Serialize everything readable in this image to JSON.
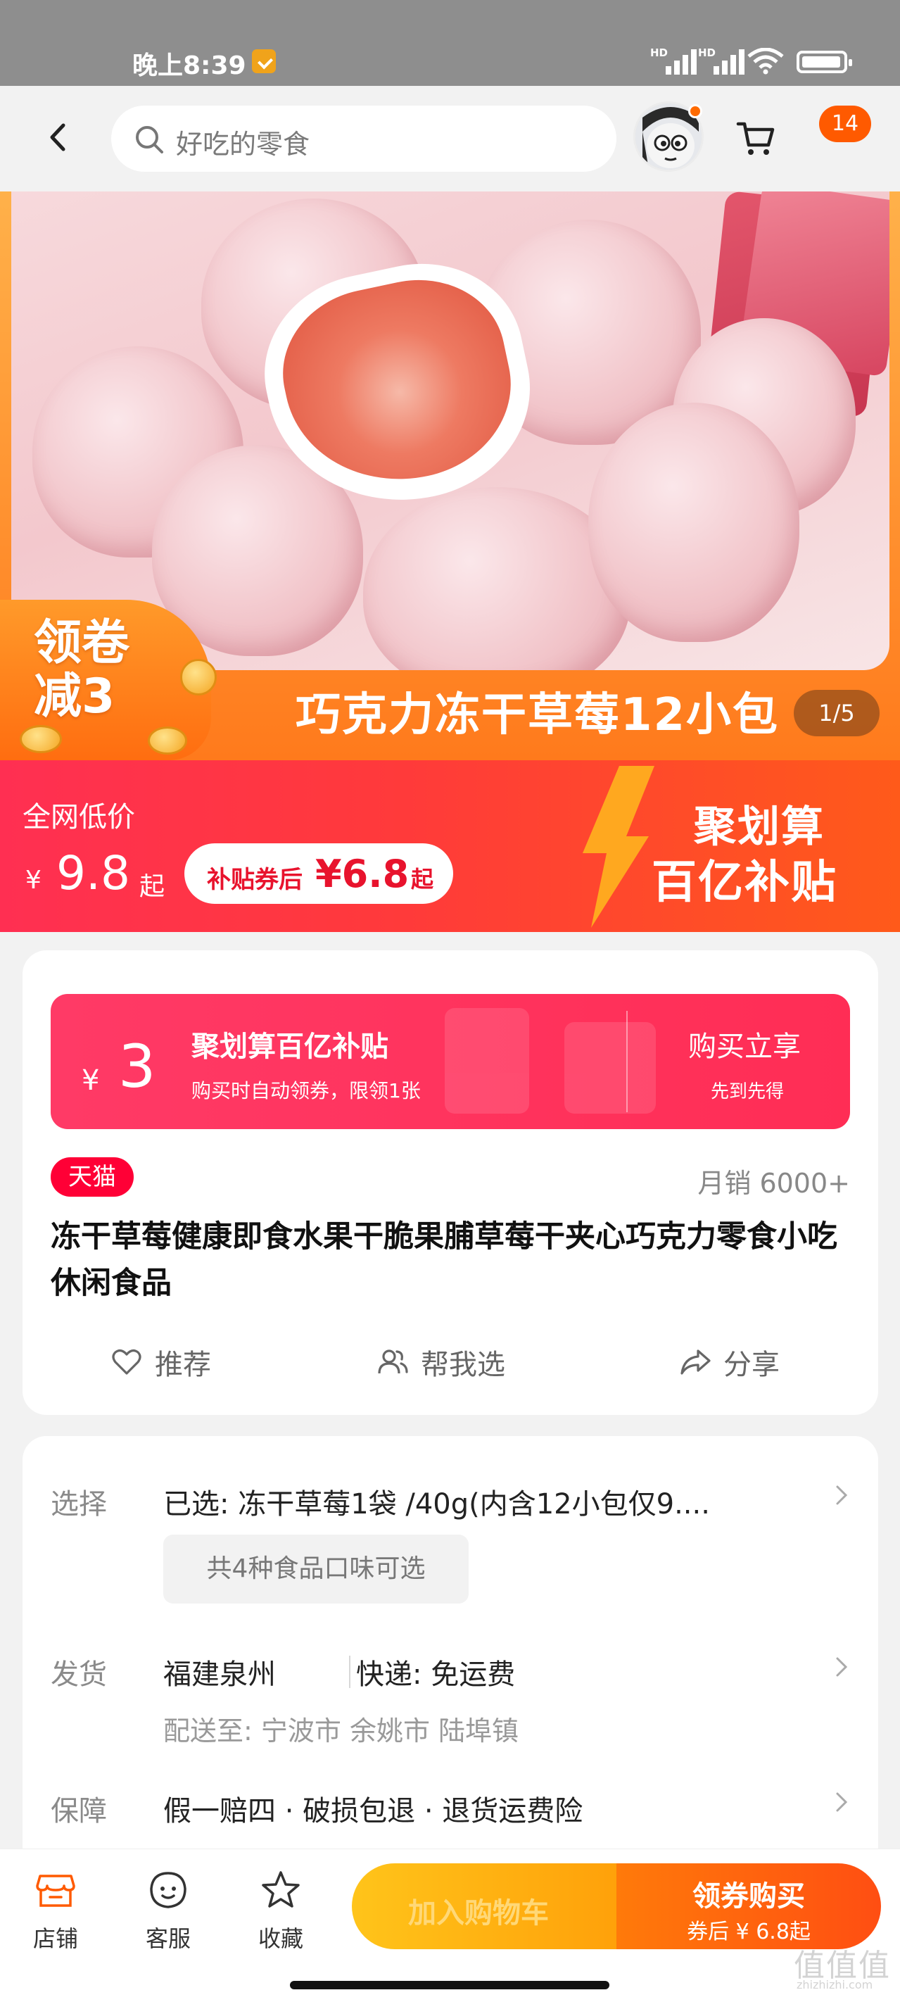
{
  "status_bar": {
    "time": "晚上8:39",
    "hd1": "HD",
    "hd2": "HD"
  },
  "header": {
    "search_placeholder": "好吃的零食",
    "more_badge": "14"
  },
  "hero": {
    "coupon_text": "领卷减3",
    "caption": "巧克力冻干草莓12小包",
    "pager": "1/5"
  },
  "price_banner": {
    "label": "全网低价",
    "currency": "¥",
    "price": "9.8",
    "price_suffix": "起",
    "subsidy_prefix": "补贴券后",
    "subsidy_price": "¥6.8",
    "subsidy_suffix": "起",
    "brand_line1": "聚划算",
    "brand_line2": "百亿补贴"
  },
  "subsidy_card": {
    "currency": "¥",
    "amount": "3",
    "title": "聚划算百亿补贴",
    "desc": "购买时自动领券，限领1张",
    "cta": "购买立享",
    "cta_sub": "先到先得"
  },
  "product": {
    "platform_badge": "天猫",
    "monthly_sales": "月销 6000+",
    "title": "冻干草莓健康即食水果干脆果脯草莓干夹心巧克力零食小吃休闲食品"
  },
  "actions": [
    {
      "label": "推荐",
      "icon": "heart-icon"
    },
    {
      "label": "帮我选",
      "icon": "people-icon"
    },
    {
      "label": "分享",
      "icon": "share-icon"
    }
  ],
  "options": {
    "select_label": "选择",
    "select_value": "已选: 冻干草莓1袋 /40g(内含12小包仅9....",
    "flavor_chip": "共4种食品口味可选",
    "ship_label": "发货",
    "ship_origin": "福建泉州",
    "ship_method": "快递: 免运费",
    "ship_to": "配送至: 宁波市 余姚市 陆埠镇",
    "guarantee_label": "保障",
    "guarantee_value": "假一赔四 · 破损包退 · 退货运费险"
  },
  "bottom_bar": {
    "store": "店铺",
    "service": "客服",
    "favorite": "收藏",
    "add_cart": "加入购物车",
    "buy": "领券购买",
    "buy_sub": "券后 ¥ 6.8起"
  },
  "watermark": {
    "main": "值值值",
    "sub": "zhizhizhi.com"
  },
  "colors": {
    "brand_orange": "#ff5a00",
    "subsidy_red": "#ff2d55",
    "tmall_red": "#ff0036"
  }
}
